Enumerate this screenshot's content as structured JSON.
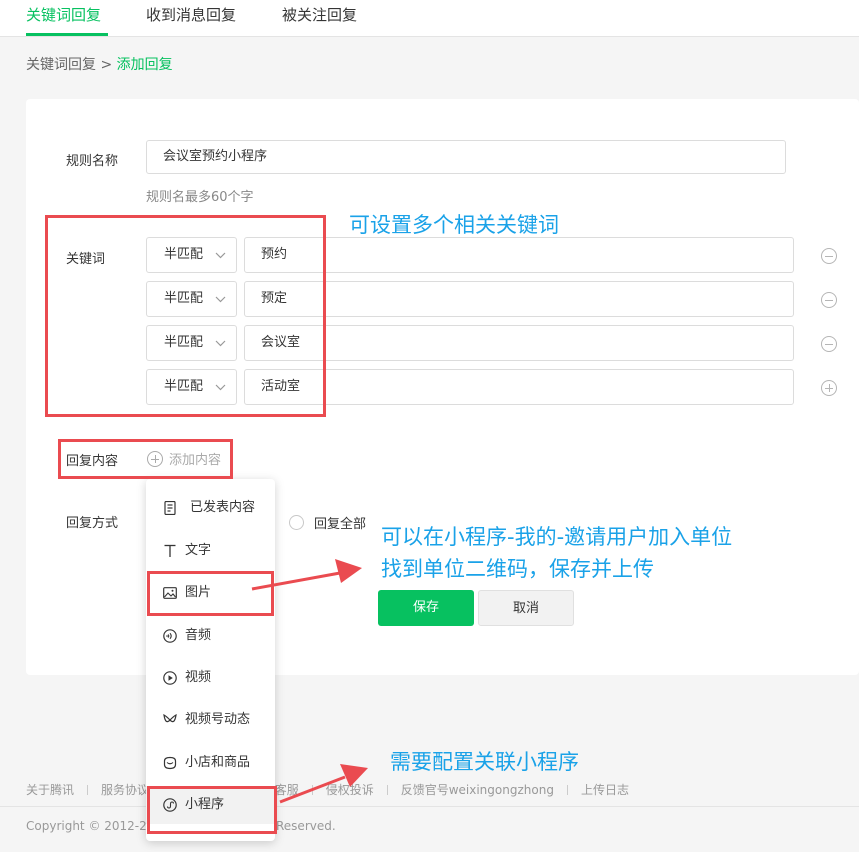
{
  "tabs": [
    "关键词回复",
    "收到消息回复",
    "被关注回复"
  ],
  "breadcrumb": {
    "parent": "关键词回复",
    "separator": ">",
    "current": "添加回复"
  },
  "form": {
    "rule_name_label": "规则名称",
    "rule_name_value": "会议室预约小程序",
    "rule_name_hint": "规则名最多60个字",
    "keywords_label": "关键词",
    "keywords": [
      {
        "match": "半匹配",
        "value": "预约",
        "action": "remove"
      },
      {
        "match": "半匹配",
        "value": "预定",
        "action": "remove"
      },
      {
        "match": "半匹配",
        "value": "会议室",
        "action": "remove"
      },
      {
        "match": "半匹配",
        "value": "活动室",
        "action": "add"
      }
    ],
    "reply_content_label": "回复内容",
    "add_content_label": "添加内容",
    "reply_mode_label": "回复方式",
    "reply_all_label": "回复全部",
    "save_label": "保存",
    "cancel_label": "取消"
  },
  "dropdown": {
    "items": [
      {
        "icon": "document-icon",
        "label": "已发表内容"
      },
      {
        "icon": "text-icon",
        "label": "文字"
      },
      {
        "icon": "image-icon",
        "label": "图片"
      },
      {
        "icon": "audio-icon",
        "label": "音频"
      },
      {
        "icon": "video-icon",
        "label": "视频"
      },
      {
        "icon": "channels-icon",
        "label": "视频号动态"
      },
      {
        "icon": "shop-icon",
        "label": "小店和商品"
      },
      {
        "icon": "miniprogram-icon",
        "label": "小程序"
      }
    ]
  },
  "annotations": {
    "keywords_note": "可设置多个相关关键词",
    "image_note_line1": "可以在小程序-我的-邀请用户加入单位",
    "image_note_line2": "找到单位二维码，保存并上传",
    "miniprogram_note": "需要配置关联小程序"
  },
  "footer": {
    "links_visible": [
      "关于腾讯",
      "服务协议",
      "客服",
      "侵权投诉",
      "反馈官号weixingongzhong",
      "上传日志"
    ],
    "copyright_left": "Copyright © 2012-20",
    "copyright_right": "Reserved."
  },
  "colors": {
    "accent": "#07c160",
    "annotation_box": "#ea4b50",
    "annotation_text": "#1aa2e8"
  }
}
